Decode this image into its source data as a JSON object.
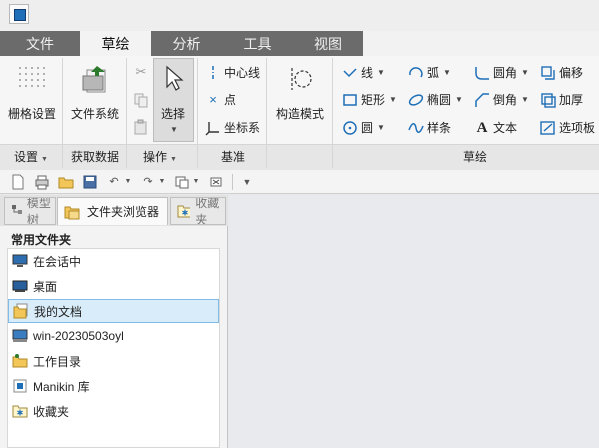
{
  "tabs": [
    {
      "label": "文件"
    },
    {
      "label": "草绘"
    },
    {
      "label": "分析"
    },
    {
      "label": "工具"
    },
    {
      "label": "视图"
    }
  ],
  "ribbon": {
    "setup": {
      "grid_label": "栅格设置",
      "group_label": "设置"
    },
    "get_data": {
      "file_system_label": "文件系统",
      "group_label": "获取数据"
    },
    "operations": {
      "select_label": "选择",
      "group_label": "操作"
    },
    "datum": {
      "centerline_label": "中心线",
      "point_label": "点",
      "csys_label": "坐标系",
      "group_label": "基准"
    },
    "sketch": {
      "construction_label": "构造模式",
      "line_label": "线",
      "rectangle_label": "矩形",
      "circle_label": "圆",
      "arc_label": "弧",
      "ellipse_label": "椭圆",
      "spline_label": "样条",
      "fillet_label": "圆角",
      "chamfer_label": "倒角",
      "text_label": "文本",
      "offset_label": "偏移",
      "thicken_label": "加厚",
      "palette_label": "选项板",
      "group_label": "草绘"
    }
  },
  "panel": {
    "tabs": {
      "model": "模型树",
      "folder": "文件夹浏览器",
      "favorites": "收藏夹"
    },
    "common_folders_title": "常用文件夹",
    "items": [
      {
        "label": "在会话中"
      },
      {
        "label": "桌面"
      },
      {
        "label": "我的文档"
      },
      {
        "label": "win-20230503oyl"
      },
      {
        "label": "工作目录"
      },
      {
        "label": "Manikin 库"
      },
      {
        "label": "收藏夹"
      }
    ]
  },
  "colors": {
    "accent": "#1f6fb8",
    "selection": "#d8ecf9",
    "tabstrip": "#6b6b6b"
  }
}
